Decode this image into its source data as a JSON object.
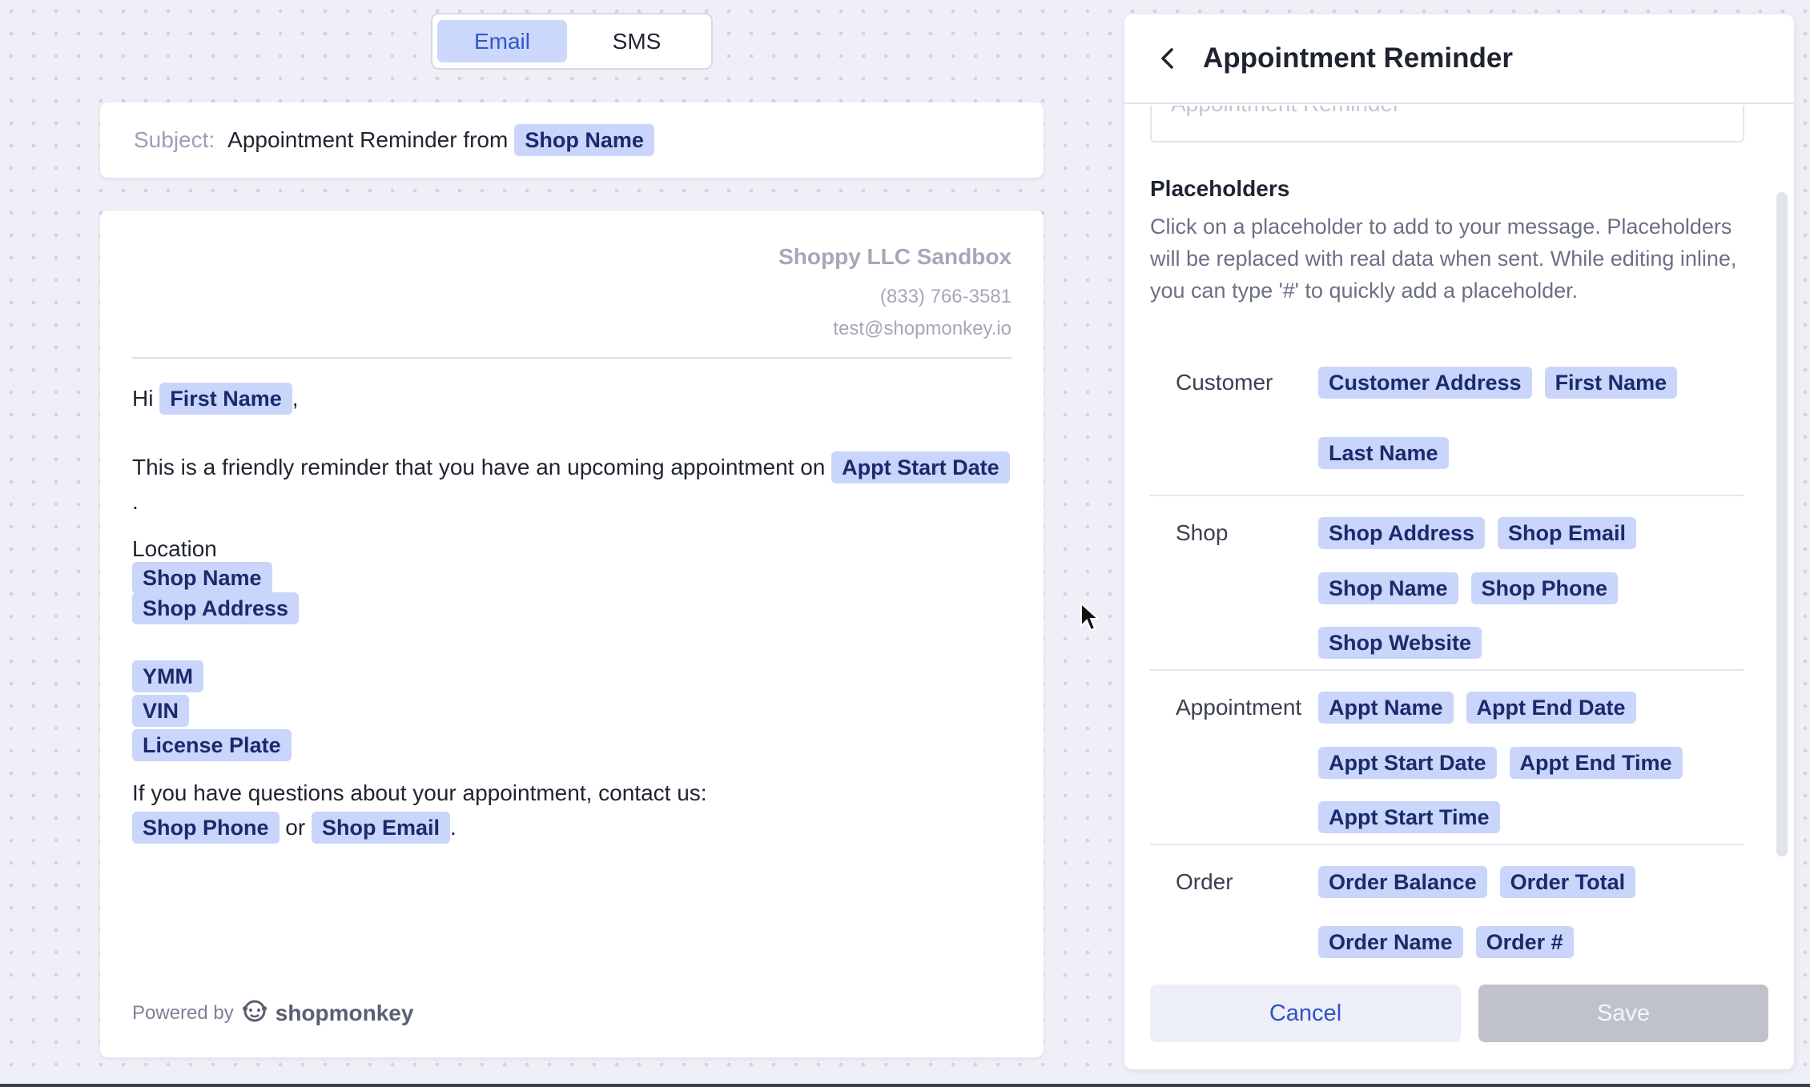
{
  "toggle": {
    "options": [
      "Email",
      "SMS"
    ],
    "selected": "Email"
  },
  "subject": {
    "label": "Subject:",
    "text": "Appointment Reminder from",
    "placeholder_chip": "Shop Name"
  },
  "email": {
    "shop_name": "Shoppy LLC Sandbox",
    "shop_phone": "(833) 766-3581",
    "shop_email": "test@shopmonkey.io",
    "greeting": "Hi",
    "greeting_chip": "First Name",
    "greeting_suffix": ",",
    "reminder_text": "This is a friendly reminder that you have an upcoming appointment on",
    "reminder_chip": "Appt Start Date",
    "reminder_end": ".",
    "location_label": "Location",
    "location_chips": [
      "Shop Name",
      "Shop Address"
    ],
    "vehicle_chips": [
      "YMM",
      "VIN",
      "License Plate"
    ],
    "contact_text": "If you have questions about your appointment, contact us:",
    "contact_chip_1": "Shop Phone",
    "contact_or": "or",
    "contact_chip_2": "Shop Email",
    "contact_end": ".",
    "powered_by": "Powered by",
    "brand": "shopmonkey"
  },
  "panel": {
    "title": "Appointment Reminder",
    "prev_input_value": "Appointment Reminder",
    "placeholders_title": "Placeholders",
    "placeholders_desc": "Click on a placeholder to add to your message. Placeholders will be replaced with real data when sent. While editing inline, you can type '#' to quickly add a placeholder.",
    "groups": [
      {
        "label": "Customer",
        "chips": [
          "Customer Address",
          "First Name",
          "Last Name"
        ]
      },
      {
        "label": "Shop",
        "chips": [
          "Shop Address",
          "Shop Email",
          "Shop Name",
          "Shop Phone",
          "Shop Website"
        ]
      },
      {
        "label": "Appointment",
        "chips": [
          "Appt Name",
          "Appt End Date",
          "Appt Start Date",
          "Appt End Time",
          "Appt Start Time"
        ]
      },
      {
        "label": "Order",
        "chips": [
          "Order Balance",
          "Order Total",
          "Order Name",
          "Order #"
        ]
      }
    ],
    "cancel_label": "Cancel",
    "save_label": "Save"
  },
  "colors": {
    "chip_bg": "#c9d5fb",
    "chip_text": "#1b2a6b",
    "accent": "#2f52c2",
    "save_disabled": "#bfc2cc"
  },
  "icons": {
    "back": "chevron-left-icon",
    "brand": "monkey-logo-icon",
    "cursor": "mouse-pointer-icon"
  }
}
